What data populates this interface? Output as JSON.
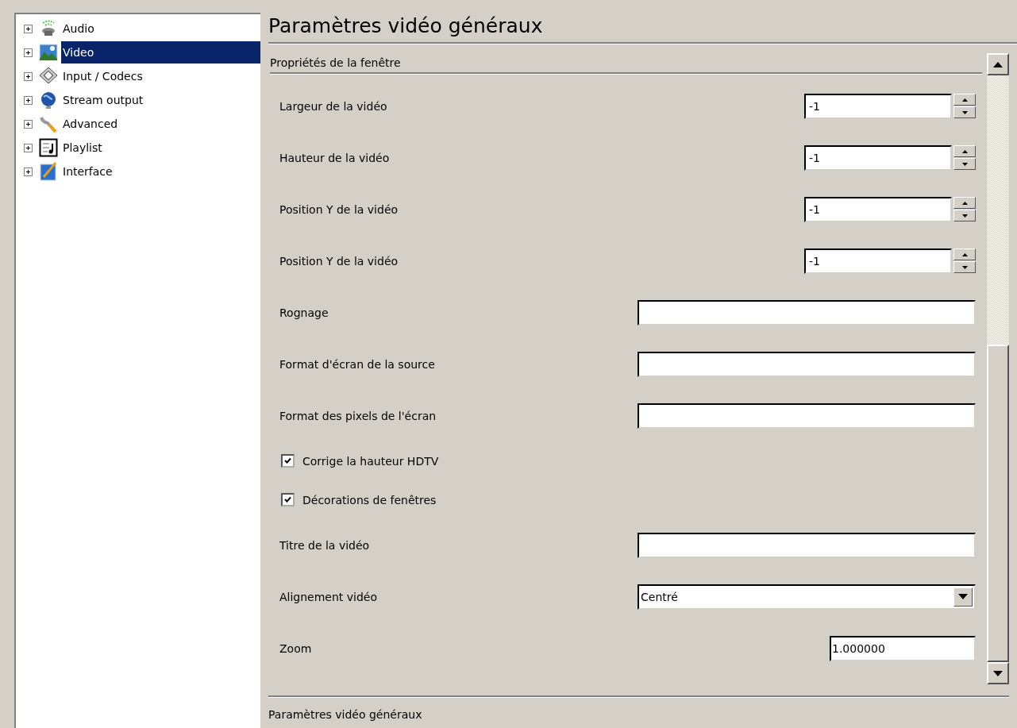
{
  "tree": [
    {
      "label": "Audio",
      "selected": false
    },
    {
      "label": "Video",
      "selected": true
    },
    {
      "label": "Input / Codecs",
      "selected": false
    },
    {
      "label": "Stream output",
      "selected": false
    },
    {
      "label": "Advanced",
      "selected": false
    },
    {
      "label": "Playlist",
      "selected": false
    },
    {
      "label": "Interface",
      "selected": false
    }
  ],
  "title": "Paramètres vidéo généraux",
  "section": "Propriétés de la fenêtre",
  "options": [
    {
      "kind": "spin",
      "label": "Largeur de la vidéo",
      "value": "-1"
    },
    {
      "kind": "spin",
      "label": "Hauteur de la vidéo",
      "value": "-1"
    },
    {
      "kind": "spin",
      "label": "Position Y de la vidéo",
      "value": "-1"
    },
    {
      "kind": "spin",
      "label": "Position Y de la vidéo",
      "value": "-1"
    },
    {
      "kind": "text",
      "label": "Rognage"
    },
    {
      "kind": "text",
      "label": "Format d'écran de la source"
    },
    {
      "kind": "text",
      "label": "Format des pixels de l'écran"
    },
    {
      "kind": "check",
      "label": "Corrige la hauteur HDTV",
      "checked": true
    },
    {
      "kind": "check",
      "label": "Décorations de fenêtres",
      "checked": true
    },
    {
      "kind": "text",
      "label": "Titre de la vidéo"
    },
    {
      "kind": "select",
      "label": "Alignement vidéo",
      "value": "Centré"
    },
    {
      "kind": "float",
      "label": "Zoom",
      "value": "1.000000"
    }
  ],
  "footer": "Paramètres vidéo généraux"
}
